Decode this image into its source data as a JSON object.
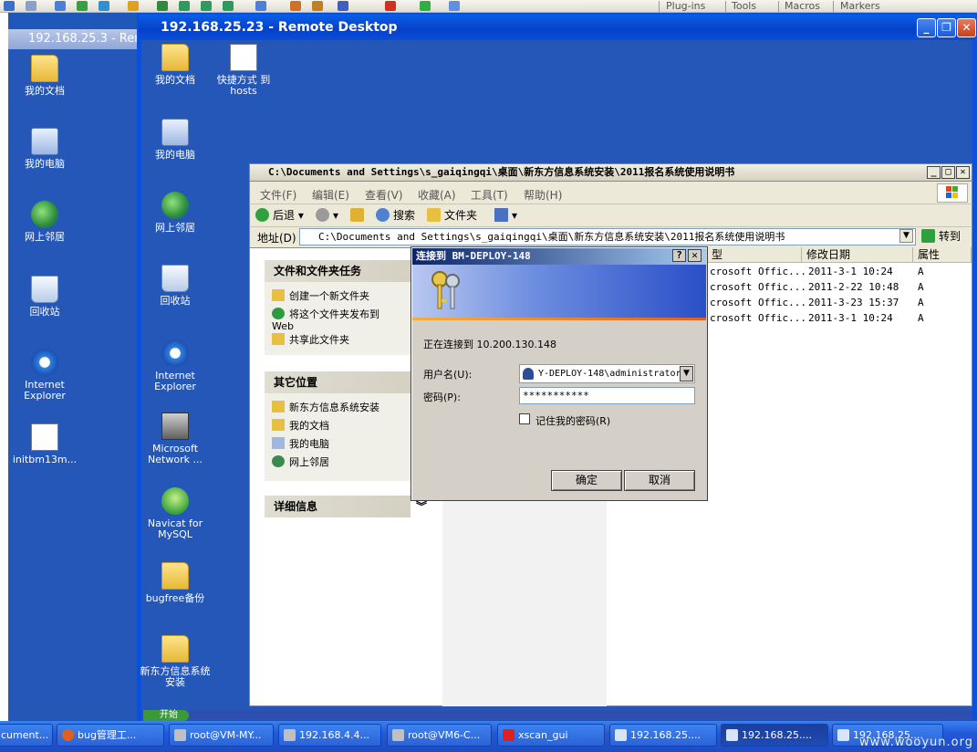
{
  "host_toolbar": {
    "menus": [
      "Plug-ins",
      "Tools",
      "Macros",
      "Markers"
    ]
  },
  "rd_left": {
    "title": "192.168.25.3 - Rer",
    "icons": [
      "我的文档",
      "我的电脑",
      "网上邻居",
      "回收站",
      "Internet Explorer",
      "initbm13m..."
    ]
  },
  "rd_main": {
    "title": "192.168.25.23 - Remote Desktop",
    "icons": [
      "我的文档",
      "快捷方式 到 hosts",
      "我的电脑",
      "网上邻居",
      "回收站",
      "Internet Explorer",
      "Microsoft Network ...",
      "Navicat for MySQL",
      "bugfree备份",
      "新东方信息系统安装"
    ]
  },
  "explorer": {
    "title": "C:\\Documents and Settings\\s_gaiqingqi\\桌面\\新东方信息系统安装\\2011报名系统使用说明书",
    "menu": [
      "文件(F)",
      "编辑(E)",
      "查看(V)",
      "收藏(A)",
      "工具(T)",
      "帮助(H)"
    ],
    "toolbar": {
      "back": "后退",
      "search": "搜索",
      "folders": "文件夹"
    },
    "address_label": "地址(D)",
    "address_value": "C:\\Documents and Settings\\s_gaiqingqi\\桌面\\新东方信息系统安装\\2011报名系统使用说明书",
    "go": "转到",
    "task_pane": {
      "file_tasks_title": "文件和文件夹任务",
      "file_tasks": [
        "创建一个新文件夹",
        "将这个文件夹发布到 Web",
        "共享此文件夹"
      ],
      "other_places_title": "其它位置",
      "other_places": [
        "新东方信息系统安装",
        "我的文档",
        "我的电脑",
        "网上邻居"
      ],
      "details_title": "详细信息"
    },
    "columns": [
      "型",
      "修改日期",
      "属性"
    ],
    "rows": [
      {
        "type": "crosoft Offic...",
        "date": "2011-3-1 10:24",
        "attr": "A"
      },
      {
        "type": "crosoft Offic...",
        "date": "2011-2-22 10:48",
        "attr": "A"
      },
      {
        "type": "crosoft Offic...",
        "date": "2011-3-23 15:37",
        "attr": "A"
      },
      {
        "type": "crosoft Offic...",
        "date": "2011-3-1 10:24",
        "attr": "A"
      }
    ]
  },
  "dialog": {
    "title": "连接到 BM-DEPLOY-148",
    "connecting": "正在连接到 10.200.130.148",
    "username_label": "用户名(U):",
    "username_value": "Y-DEPLOY-148\\administrator",
    "password_label": "密码(P):",
    "password_value": "***********",
    "remember": "记住我的密码(R)",
    "ok": "确定",
    "cancel": "取消"
  },
  "rd_taskbar": {
    "start": "开始"
  },
  "taskbar": {
    "buttons": [
      "cument...",
      "bug管理工...",
      "root@VM-MY...",
      "192.168.4.4...",
      "root@VM6-C...",
      "xscan_gui",
      "192.168.25....",
      "192.168.25....",
      "192.168.25...."
    ]
  },
  "watermark": "www.wooyun.org"
}
